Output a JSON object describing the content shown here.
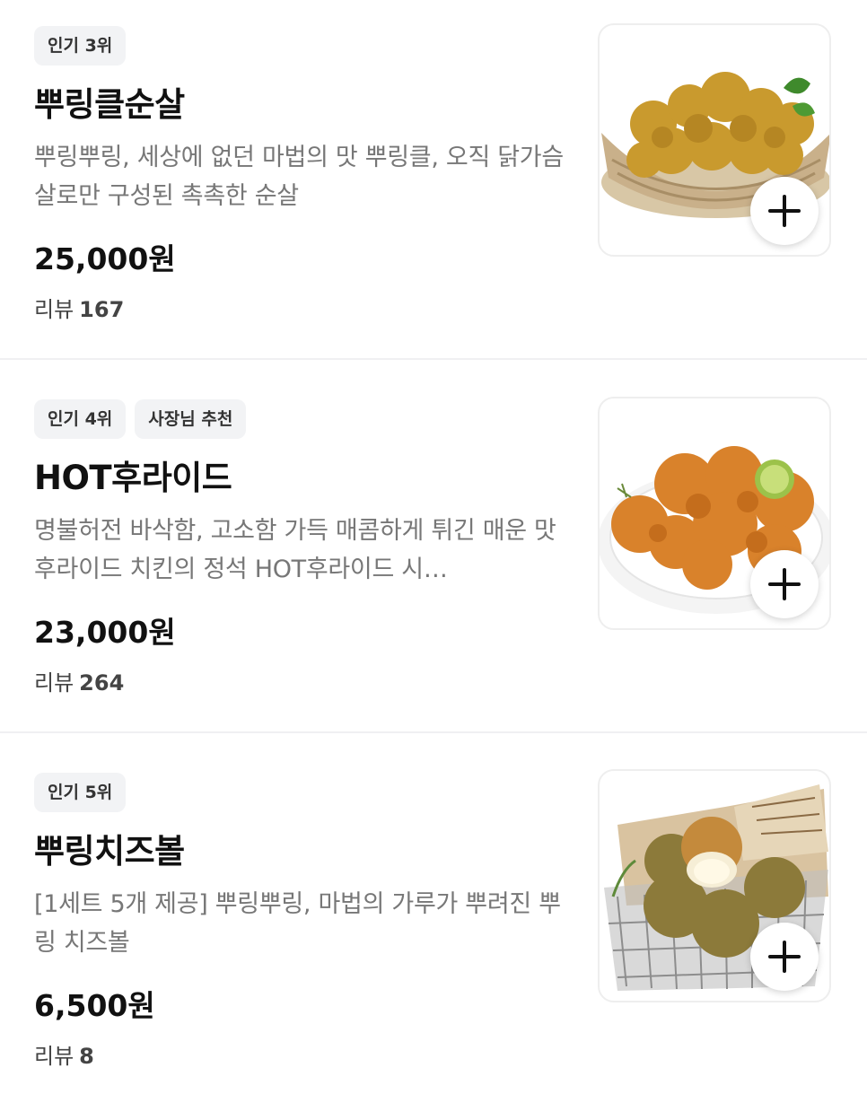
{
  "menu": {
    "items": [
      {
        "badges": [
          "인기 3위"
        ],
        "name": "뿌링클순살",
        "description": "뿌링뿌링, 세상에 없던 마법의 맛 뿌링클, 오직 닭가슴살로만 구성된 촉촉한 순살",
        "price": "25,000원",
        "review_label": "리뷰",
        "review_count": "167",
        "image_icon": "boneless-chicken-basket-image"
      },
      {
        "badges": [
          "인기 4위",
          "사장님 추천"
        ],
        "name": "HOT후라이드",
        "description": "명불허전 바삭함, 고소함 가득 매콤하게 튀긴 매운 맛 후라이드 치킨의 정석 HOT후라이드 시…",
        "price": "23,000원",
        "review_label": "리뷰",
        "review_count": "264",
        "image_icon": "fried-chicken-plate-image"
      },
      {
        "badges": [
          "인기 5위"
        ],
        "name": "뿌링치즈볼",
        "description": "[1세트 5개 제공] 뿌링뿌링, 마법의 가루가 뿌려진 뿌링 치즈볼",
        "price": "6,500원",
        "review_label": "리뷰",
        "review_count": "8",
        "image_icon": "cheese-ball-basket-image"
      }
    ]
  },
  "colors": {
    "badge_bg": "#f2f3f5",
    "description": "#777777",
    "divider": "#f0f0f2",
    "text": "#111111"
  }
}
